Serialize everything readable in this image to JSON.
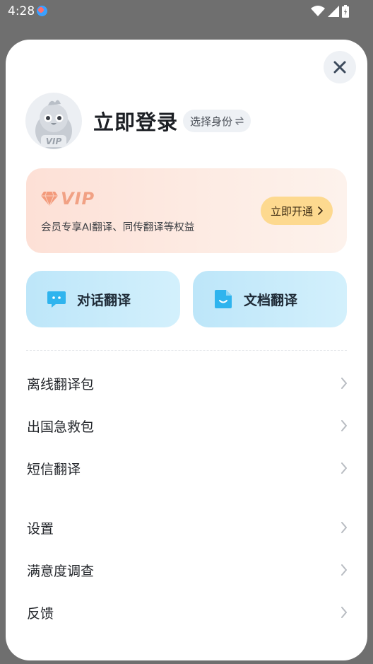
{
  "status_bar": {
    "time": "4:28"
  },
  "header": {
    "login_label": "立即登录",
    "identity_label": "选择身份",
    "avatar_badge": "VIP"
  },
  "vip_card": {
    "logo_text": "VIP",
    "description": "会员专享AI翻译、同传翻译等权益",
    "button_label": "立即开通"
  },
  "features": [
    {
      "label": "对话翻译",
      "icon": "chat-bubble-icon"
    },
    {
      "label": "文档翻译",
      "icon": "document-icon"
    }
  ],
  "menu_group_1": [
    {
      "label": "离线翻译包"
    },
    {
      "label": "出国急救包"
    },
    {
      "label": "短信翻译"
    }
  ],
  "menu_group_2": [
    {
      "label": "设置"
    },
    {
      "label": "满意度调查"
    },
    {
      "label": "反馈"
    }
  ],
  "colors": {
    "vip_accent": "#f1a184",
    "vip_button": "#fdd98f",
    "feature_card": "#c8ecfb",
    "feature_icon": "#2fb4ee"
  }
}
